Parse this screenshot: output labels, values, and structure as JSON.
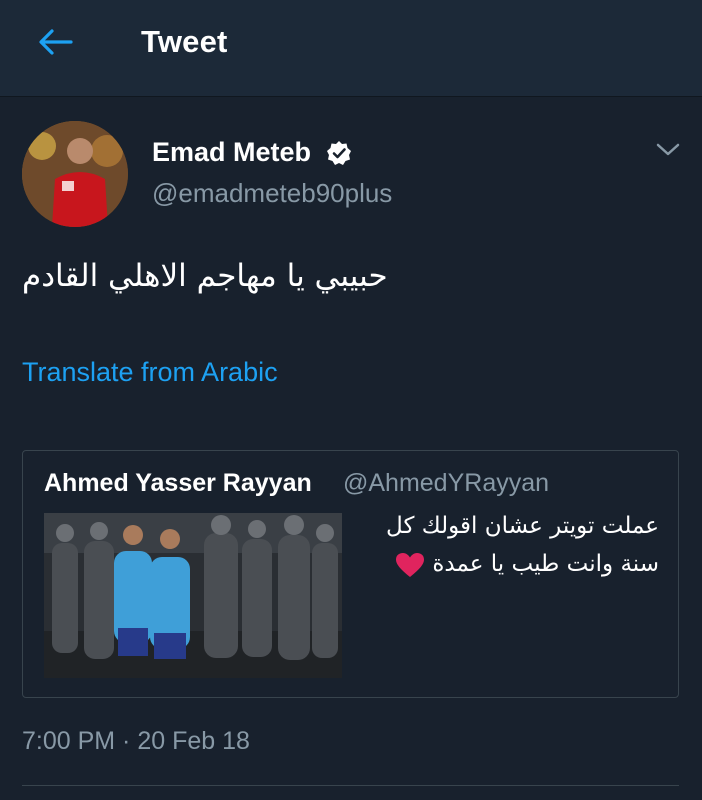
{
  "header": {
    "title": "Tweet",
    "back_icon": "arrow-left-icon"
  },
  "tweet": {
    "author_name": "Emad Meteb",
    "author_handle": "@emadmeteb90plus",
    "verified": true,
    "text": "حبيبي يا مهاجم الاهلي القادم",
    "translate_label": "Translate from Arabic",
    "timestamp": "7:00 PM · 20 Feb 18"
  },
  "quote": {
    "author_name": "Ahmed Yasser Rayyan",
    "author_handle": "@AhmedYRayyan",
    "text_line1": "عملت تويتر عشان اقولك كل",
    "text_line2": "سنة وانت طيب يا عمدة"
  },
  "colors": {
    "background": "#18212d",
    "header_bg": "#1c2938",
    "accent": "#1da1f2",
    "secondary_text": "#8899a6",
    "border": "#38444d",
    "heart": "#e0245e"
  }
}
